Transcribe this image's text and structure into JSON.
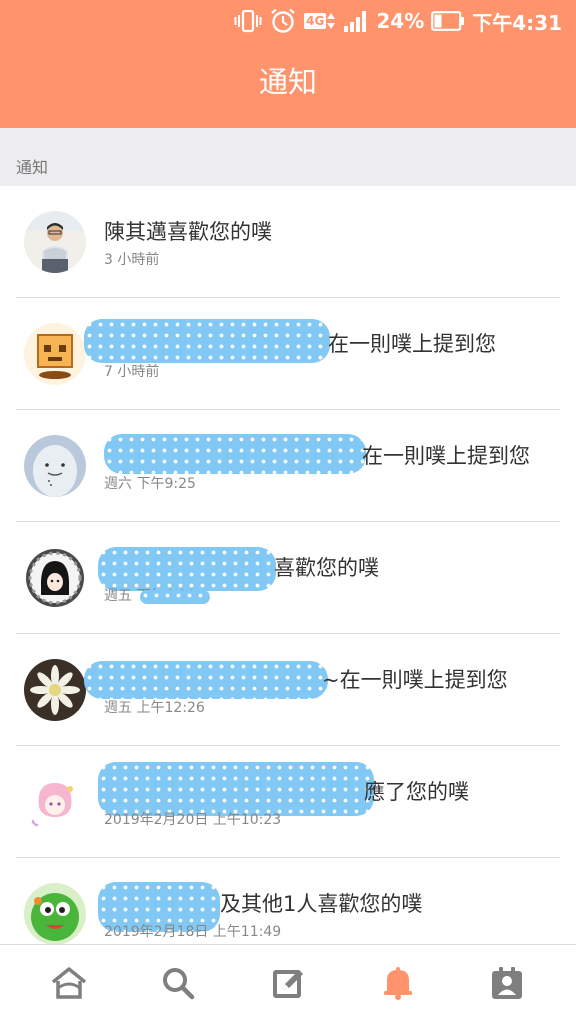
{
  "status_bar": {
    "battery_percent": "24%",
    "network": "4G",
    "time": "下午4:31"
  },
  "header": {
    "title": "通知"
  },
  "section": {
    "label": "通知"
  },
  "notifications": [
    {
      "text": "陳其邁喜歡您的噗",
      "time": "3 小時前",
      "avatar_icon": "man-photo-avatar"
    },
    {
      "text": "在一則噗上提到您",
      "time": "7 小時前",
      "avatar_icon": "box-character-avatar"
    },
    {
      "text": "在一則噗上提到您",
      "time": "週六 下午9:25",
      "avatar_icon": "ghost-avatar"
    },
    {
      "text": "喜歡您的噗",
      "time": "週五 下午4:20",
      "avatar_icon": "anime-girl-avatar"
    },
    {
      "text": "~在一則噗上提到您",
      "time": "週五 上午12:26",
      "avatar_icon": "flower-avatar"
    },
    {
      "text": "應了您的噗",
      "time": "2019年2月20日 上午10:23",
      "avatar_icon": "pink-hair-avatar"
    },
    {
      "text": "及其他1人喜歡您的噗",
      "time": "2019年2月18日 上午11:49",
      "avatar_icon": "green-creature-avatar"
    }
  ],
  "bottom_nav": [
    {
      "name": "home",
      "icon": "home-icon"
    },
    {
      "name": "search",
      "icon": "search-icon"
    },
    {
      "name": "compose",
      "icon": "compose-icon"
    },
    {
      "name": "notifications",
      "icon": "bell-icon",
      "active": true
    },
    {
      "name": "profile",
      "icon": "profile-card-icon"
    }
  ],
  "colors": {
    "header": "#ff936b",
    "active_tab": "#ff936b",
    "inactive_tab": "#7f7f7f",
    "censor": "#81c8f4"
  }
}
